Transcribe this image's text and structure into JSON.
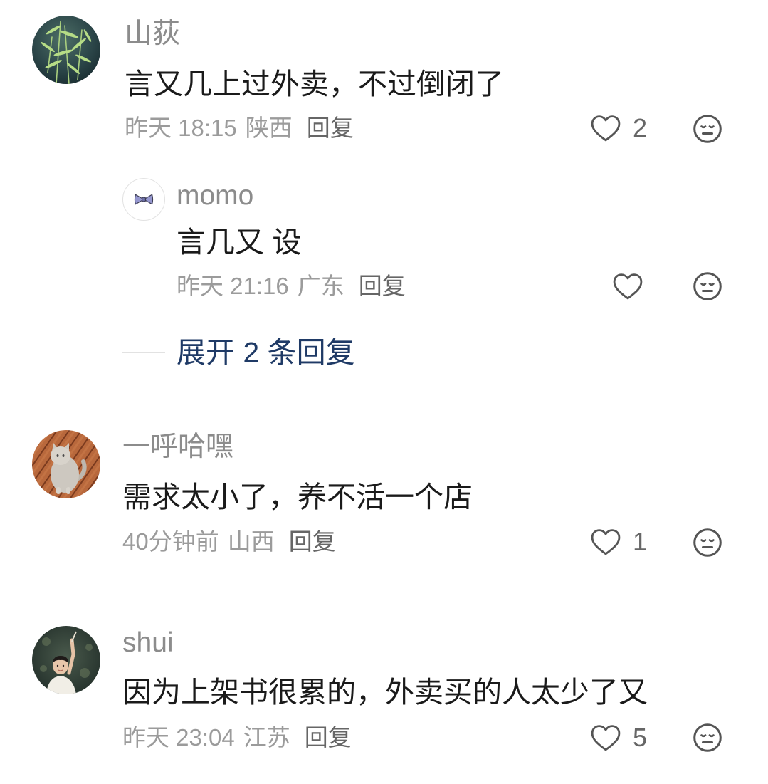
{
  "theme": {
    "text_color": "#1a1a1a",
    "username_color": "#8c8c8c",
    "meta_color": "#9b9b9b",
    "reply_label_color": "#666666",
    "count_color": "#666666",
    "link_color": "#1f3a66",
    "icon_color": "#555555",
    "divider_color": "#e2e2e2"
  },
  "icons": {
    "like": "heart-outline-icon",
    "dislike": "meh-face-icon"
  },
  "comments": [
    {
      "username": "山荻",
      "content": "言又几上过外卖，不过倒闭了",
      "time": "昨天 18:15",
      "location": "陕西",
      "reply_label": "回复",
      "likes": 2,
      "replies": [
        {
          "username": "momo",
          "content": "言几又 设",
          "time": "昨天 21:16",
          "location": "广东",
          "reply_label": "回复"
        }
      ],
      "expand_label": "展开 2 条回复"
    },
    {
      "username": "一呼哈嘿",
      "content": "需求太小了，养不活一个店",
      "time": "40分钟前",
      "location": "山西",
      "reply_label": "回复",
      "likes": 1
    },
    {
      "username": "shui",
      "content": "因为上架书很累的，外卖买的人太少了又",
      "time": "昨天 23:04",
      "location": "江苏",
      "reply_label": "回复",
      "likes": 5
    }
  ]
}
